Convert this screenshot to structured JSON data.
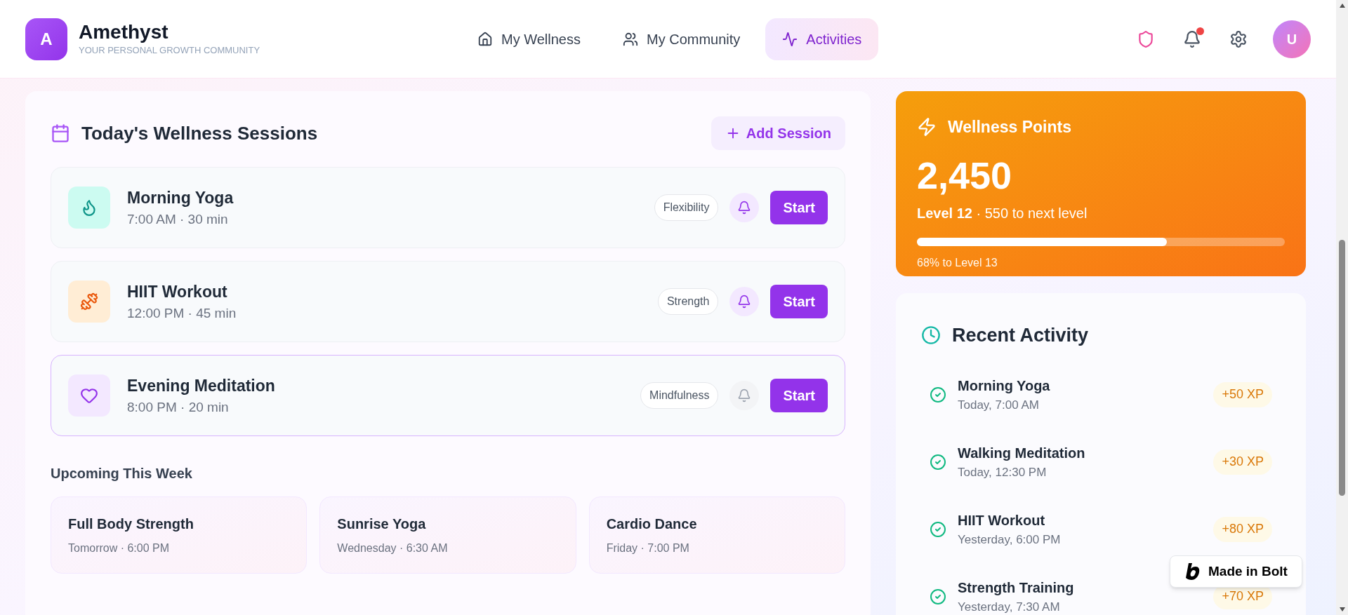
{
  "header": {
    "logo_letter": "A",
    "title": "Amethyst",
    "subtitle": "YOUR PERSONAL GROWTH COMMUNITY",
    "nav": [
      {
        "label": "My Wellness",
        "kind": "home",
        "selected": false
      },
      {
        "label": "My Community",
        "kind": "community",
        "selected": false
      },
      {
        "label": "Activities",
        "kind": "activity",
        "selected": true
      }
    ],
    "notifications_unread": true,
    "avatar": "U"
  },
  "sessions_panel": {
    "title": "Today's Wellness Sessions",
    "add_button": "Add Session",
    "sessions": [
      {
        "name": "Morning Yoga",
        "time": "7:00 AM · 30 min",
        "tag": "Flexibility",
        "kind": "yoga",
        "reminder": true,
        "selected": false,
        "button": "Start"
      },
      {
        "name": "HIIT Workout",
        "time": "12:00 PM · 45 min",
        "tag": "Strength",
        "kind": "workout",
        "reminder": true,
        "selected": false,
        "button": "Start"
      },
      {
        "name": "Evening Meditation",
        "time": "8:00 PM · 20 min",
        "tag": "Mindfulness",
        "kind": "meditation",
        "reminder": false,
        "selected": true,
        "button": "Start"
      }
    ],
    "upcoming_title": "Upcoming This Week",
    "upcoming": [
      {
        "name": "Full Body Strength",
        "when": "Tomorrow · 6:00 PM"
      },
      {
        "name": "Sunrise Yoga",
        "when": "Wednesday · 6:30 AM"
      },
      {
        "name": "Cardio Dance",
        "when": "Friday · 7:00 PM"
      }
    ]
  },
  "points_card": {
    "title": "Wellness Points",
    "points": "2,450",
    "level_text": "**Level 12** · 550 to next level",
    "level": 0.68,
    "progress_label": "68% to Level 13"
  },
  "recent_activity": {
    "title": "Recent Activity",
    "items": [
      {
        "name": "Morning Yoga",
        "when": "Today, 7:00 AM",
        "xp": "+50 XP"
      },
      {
        "name": "Walking Meditation",
        "when": "Today, 12:30 PM",
        "xp": "+30 XP"
      },
      {
        "name": "HIIT Workout",
        "when": "Yesterday, 6:00 PM",
        "xp": "+80 XP"
      },
      {
        "name": "Strength Training",
        "when": "Yesterday, 7:30 AM",
        "xp": "+70 XP"
      }
    ]
  },
  "bolt_badge": "Made in Bolt"
}
